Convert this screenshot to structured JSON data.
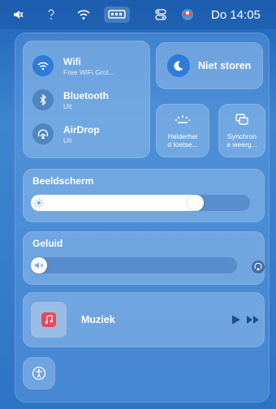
{
  "menubar": {
    "clock": "Do 14:05"
  },
  "connectivity": {
    "wifi": {
      "title": "Wifi",
      "status": "Free WiFi Grot..."
    },
    "bluetooth": {
      "title": "Bluetooth",
      "status": "Uit"
    },
    "airdrop": {
      "title": "AirDrop",
      "status": "Uit"
    }
  },
  "focus": {
    "label": "Niet storen"
  },
  "keyboard_brightness": {
    "label_line1": "Helderhei",
    "label_line2": "d toetse..."
  },
  "screen_mirroring": {
    "label_line1": "Synchron",
    "label_line2": "e weerg..."
  },
  "display": {
    "title": "Beeldscherm",
    "brightness_fraction": 0.77
  },
  "sound": {
    "title": "Geluid",
    "volume_fraction": 0.0
  },
  "now_playing": {
    "app": "Muziek"
  },
  "colors": {
    "accent": "#2f7bd8",
    "music_red": "#f0455a"
  }
}
